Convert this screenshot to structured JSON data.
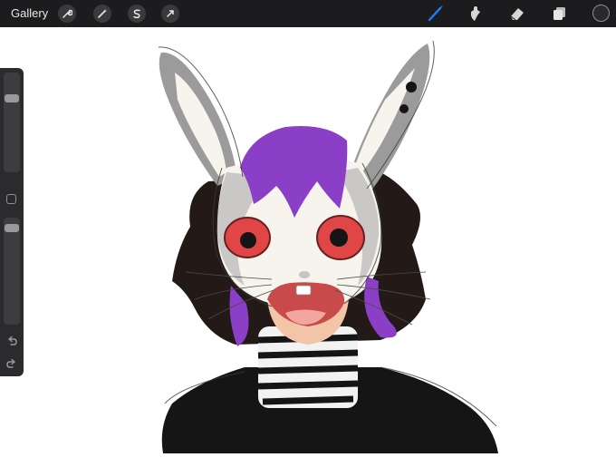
{
  "topbar": {
    "gallery_label": "Gallery",
    "left_tools": [
      "wrench-icon",
      "magic-wand-icon",
      "selection-s-icon",
      "transform-arrow-icon"
    ],
    "right_tools": [
      "brush-icon",
      "smudge-icon",
      "eraser-icon",
      "layers-icon"
    ],
    "active_tool": "brush-icon",
    "active_color": "#1a7cf5"
  },
  "sidebar": {
    "brush_size_level": 0.78,
    "opacity_level": 0.95,
    "undo_icon": "undo-icon",
    "redo_icon": "redo-icon"
  },
  "canvas": {
    "background": "#ffffff",
    "palette": {
      "purple": "#8a3fc6",
      "ear_grey": "#9b9b9b",
      "face": "#f7f4ee",
      "eye_red": "#e04646",
      "hair": "#231a17",
      "skin": "#f2c4a8",
      "mouth": "#c94a4a",
      "shirt": "#151515"
    }
  },
  "current_color": "#2a2a2c"
}
